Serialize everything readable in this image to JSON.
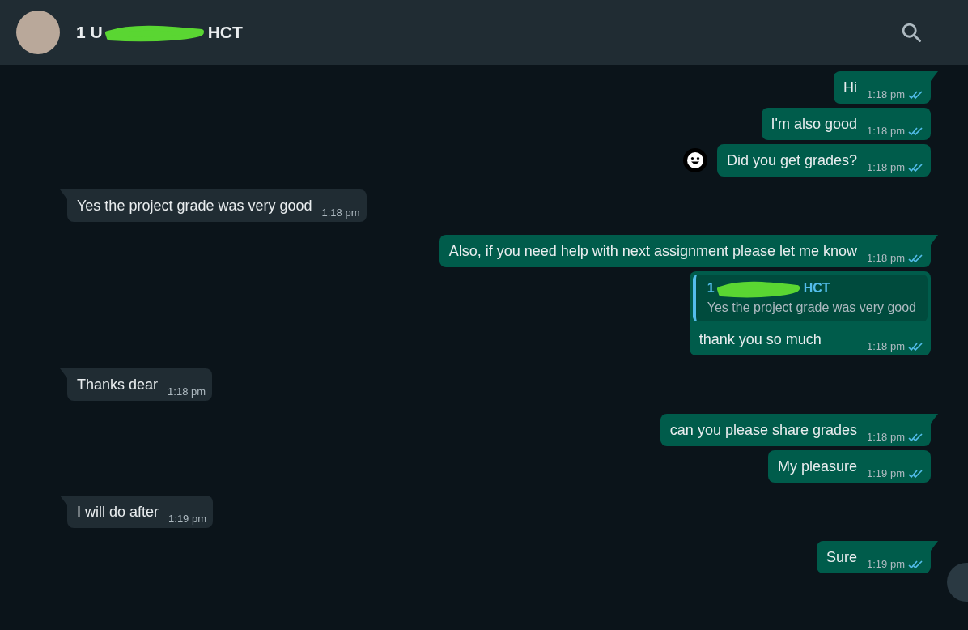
{
  "header": {
    "title_parts": [
      "1 U",
      "HCT"
    ],
    "redacted": true
  },
  "messages": [
    {
      "kind": "outgoing",
      "text": "Hi",
      "time": "1:18 pm",
      "read": true,
      "tail": true,
      "reaction_button": false
    },
    {
      "kind": "outgoing",
      "text": "I'm also good",
      "time": "1:18 pm",
      "read": true,
      "tail": false,
      "reaction_button": false
    },
    {
      "kind": "outgoing",
      "text": "Did you get grades?",
      "time": "1:18 pm",
      "read": true,
      "tail": false,
      "reaction_button": true
    },
    {
      "kind": "incoming",
      "text": "Yes the project grade was very good",
      "time": "1:18 pm",
      "tail": true
    },
    {
      "kind": "outgoing",
      "text": "Also, if you need help with next assignment please let me know",
      "time": "1:18 pm",
      "read": true,
      "tail": true,
      "reaction_button": false
    },
    {
      "kind": "outgoing",
      "text": "thank you so much",
      "time": "1:18 pm",
      "read": true,
      "tail": false,
      "reaction_button": false,
      "quote": {
        "name_parts": [
          "1",
          "HCT"
        ],
        "redacted": true,
        "text": "Yes the project grade was very good"
      }
    },
    {
      "kind": "incoming",
      "text": "Thanks dear",
      "time": "1:18 pm",
      "tail": true
    },
    {
      "kind": "outgoing",
      "text": "can you please share grades",
      "time": "1:18 pm",
      "read": true,
      "tail": true,
      "reaction_button": false
    },
    {
      "kind": "outgoing",
      "text": "My pleasure",
      "time": "1:19 pm",
      "read": true,
      "tail": false,
      "reaction_button": false
    },
    {
      "kind": "incoming",
      "text": "I will do after",
      "time": "1:19 pm",
      "tail": true
    },
    {
      "kind": "outgoing",
      "text": "Sure",
      "time": "1:19 pm",
      "read": true,
      "tail": true,
      "reaction_button": false
    }
  ]
}
